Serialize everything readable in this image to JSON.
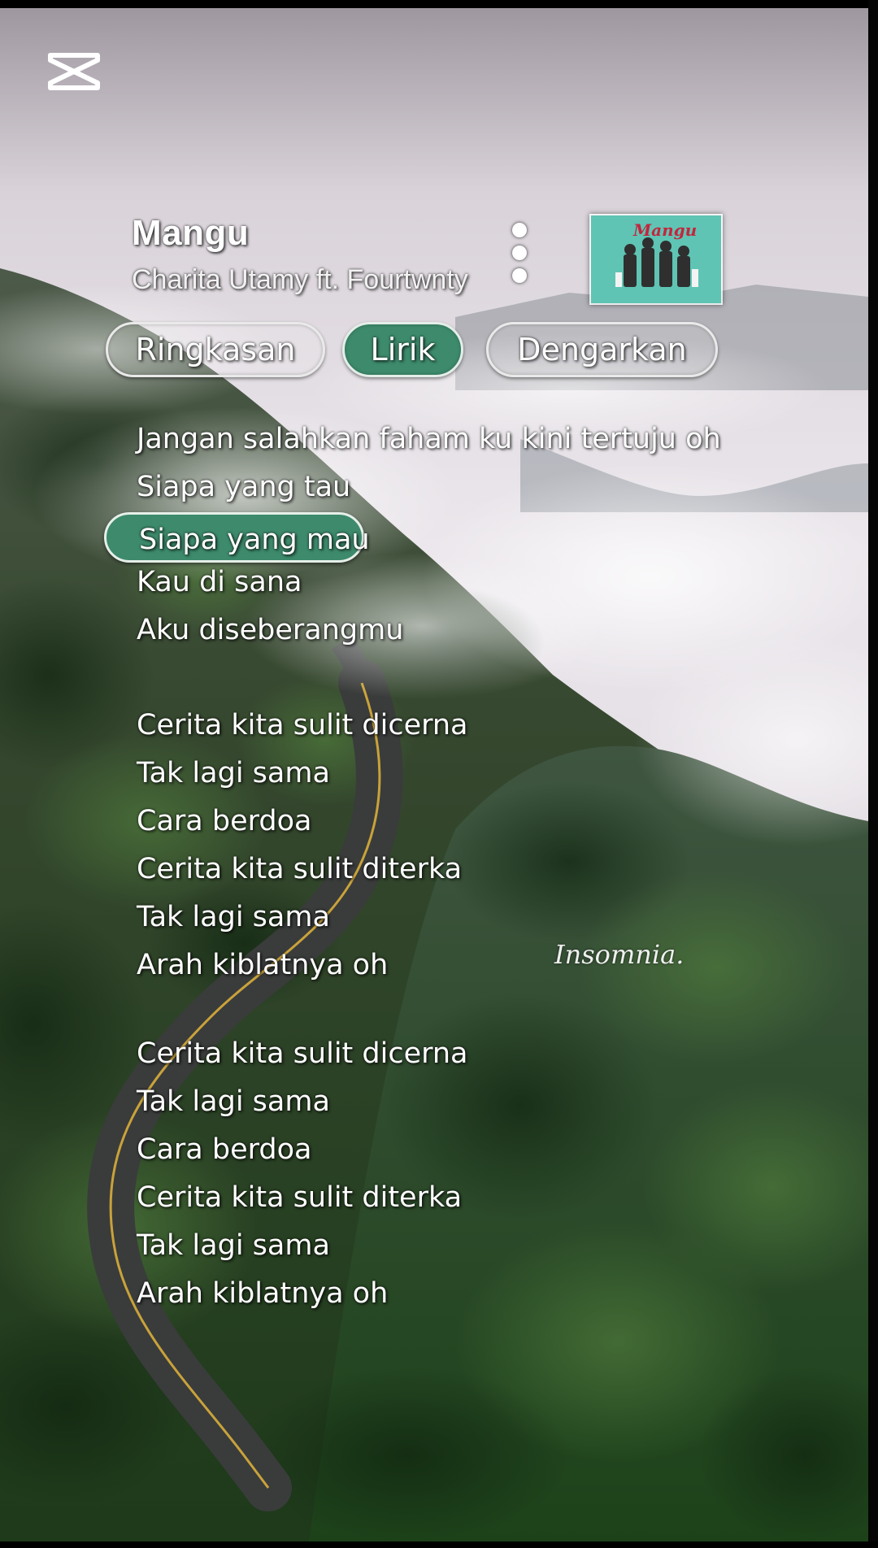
{
  "song": {
    "title": "Mangu",
    "artist": "Charita Utamy ft. Fourtwnty",
    "album_art_text": "Mangu"
  },
  "tabs": [
    {
      "label": "Ringkasan",
      "active": false
    },
    {
      "label": "Lirik",
      "active": true
    },
    {
      "label": "Dengarkan",
      "active": false
    }
  ],
  "lyrics": [
    {
      "text": "Jangan salahkan faham ku kini tertuju oh"
    },
    {
      "text": "Siapa yang tau"
    },
    {
      "text": "Siapa yang mau",
      "current": true
    },
    {
      "text": "Kau di sana"
    },
    {
      "text": "Aku diseberangmu"
    },
    {
      "text": "Cerita kita sulit dicerna"
    },
    {
      "text": "Tak lagi sama"
    },
    {
      "text": "Cara berdoa"
    },
    {
      "text": "Cerita kita sulit diterka"
    },
    {
      "text": "Tak lagi sama"
    },
    {
      "text": "Arah kiblatnya oh"
    },
    {
      "text": "Cerita kita sulit dicerna"
    },
    {
      "text": "Tak lagi sama"
    },
    {
      "text": "Cara berdoa"
    },
    {
      "text": "Cerita kita sulit diterka"
    },
    {
      "text": "Tak lagi sama"
    },
    {
      "text": "Arah kiblatnya oh"
    }
  ],
  "watermark": "Insomnia.",
  "icons": {
    "app_logo": "capcut-logo-icon",
    "more": "more-vertical-icon"
  },
  "colors": {
    "accent_green": "#3d8a6c",
    "text": "#ffffff",
    "album_title": "#c2263d",
    "album_bg": "#5fc4b4"
  }
}
